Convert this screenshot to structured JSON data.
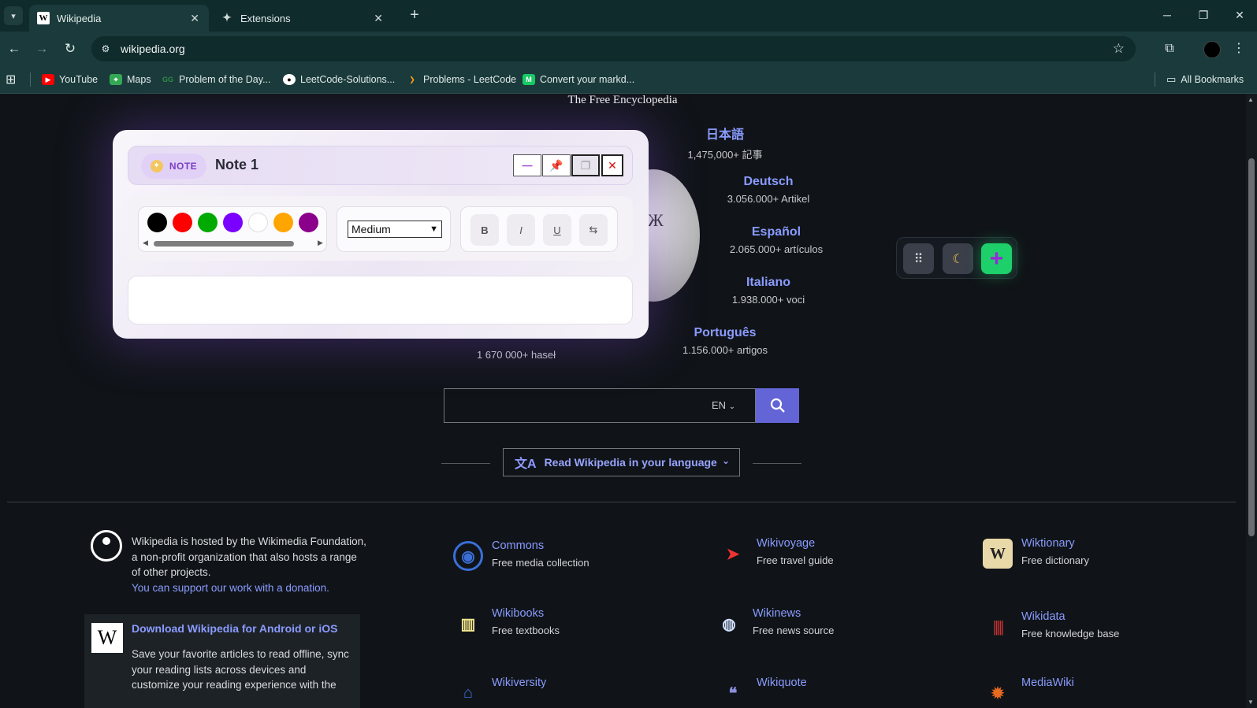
{
  "browser": {
    "tabs": [
      {
        "title": "Wikipedia",
        "active": true
      },
      {
        "title": "Extensions",
        "active": false
      }
    ],
    "url": "wikipedia.org",
    "bookmarks": [
      {
        "label": "YouTube",
        "icon": "youtube-icon"
      },
      {
        "label": "Maps",
        "icon": "maps-icon"
      },
      {
        "label": "Problem of the Day...",
        "icon": "gfg-icon"
      },
      {
        "label": "LeetCode-Solutions...",
        "icon": "github-icon"
      },
      {
        "label": "Problems - LeetCode",
        "icon": "leetcode-icon"
      },
      {
        "label": "Convert your markd...",
        "icon": "markdown-icon"
      }
    ],
    "all_bookmarks": "All Bookmarks"
  },
  "wiki": {
    "tagline": "The Free Encyclopedia",
    "languages": [
      {
        "name": "日本語",
        "count": "1,475,000+ 記事"
      },
      {
        "name": "Deutsch",
        "count": "3.056.000+ Artikel"
      },
      {
        "name": "Español",
        "count": "2.065.000+ artículos"
      },
      {
        "name": "Italiano",
        "count": "1.938.000+ voci"
      },
      {
        "name": "Português",
        "count": "1.156.000+ artigos"
      }
    ],
    "polish_count": "1 670 000+ haseł",
    "search_lang": "EN",
    "read_in_language": "Read Wikipedia in your language",
    "hosted_text": "Wikipedia is hosted by the Wikimedia Foundation, a non-profit organization that also hosts a range of other projects.",
    "donation_link": "You can support our work with a donation.",
    "download_title": "Download Wikipedia for Android or iOS",
    "download_desc": "Save your favorite articles to read offline, sync your reading lists across devices and customize your reading experience with the",
    "projects": [
      {
        "name": "Commons",
        "desc": "Free media collection"
      },
      {
        "name": "Wikivoyage",
        "desc": "Free travel guide"
      },
      {
        "name": "Wiktionary",
        "desc": "Free dictionary"
      },
      {
        "name": "Wikibooks",
        "desc": "Free textbooks"
      },
      {
        "name": "Wikinews",
        "desc": "Free news source"
      },
      {
        "name": "Wikidata",
        "desc": "Free knowledge base"
      },
      {
        "name": "Wikiversity",
        "desc": ""
      },
      {
        "name": "Wikiquote",
        "desc": ""
      },
      {
        "name": "MediaWiki",
        "desc": ""
      }
    ]
  },
  "note": {
    "badge": "NOTE",
    "title": "Note 1",
    "colors": [
      "#000000",
      "#ff0000",
      "#00aa00",
      "#7a00ff",
      "#ffffff",
      "#ffa500",
      "#8b008b"
    ],
    "size": "Medium",
    "format_buttons": [
      "B",
      "I",
      "U",
      "⇆"
    ]
  },
  "colors": {
    "accent_link": "#8a9bff",
    "search_button": "#6364d6",
    "launcher_add": "#1dd06a"
  }
}
